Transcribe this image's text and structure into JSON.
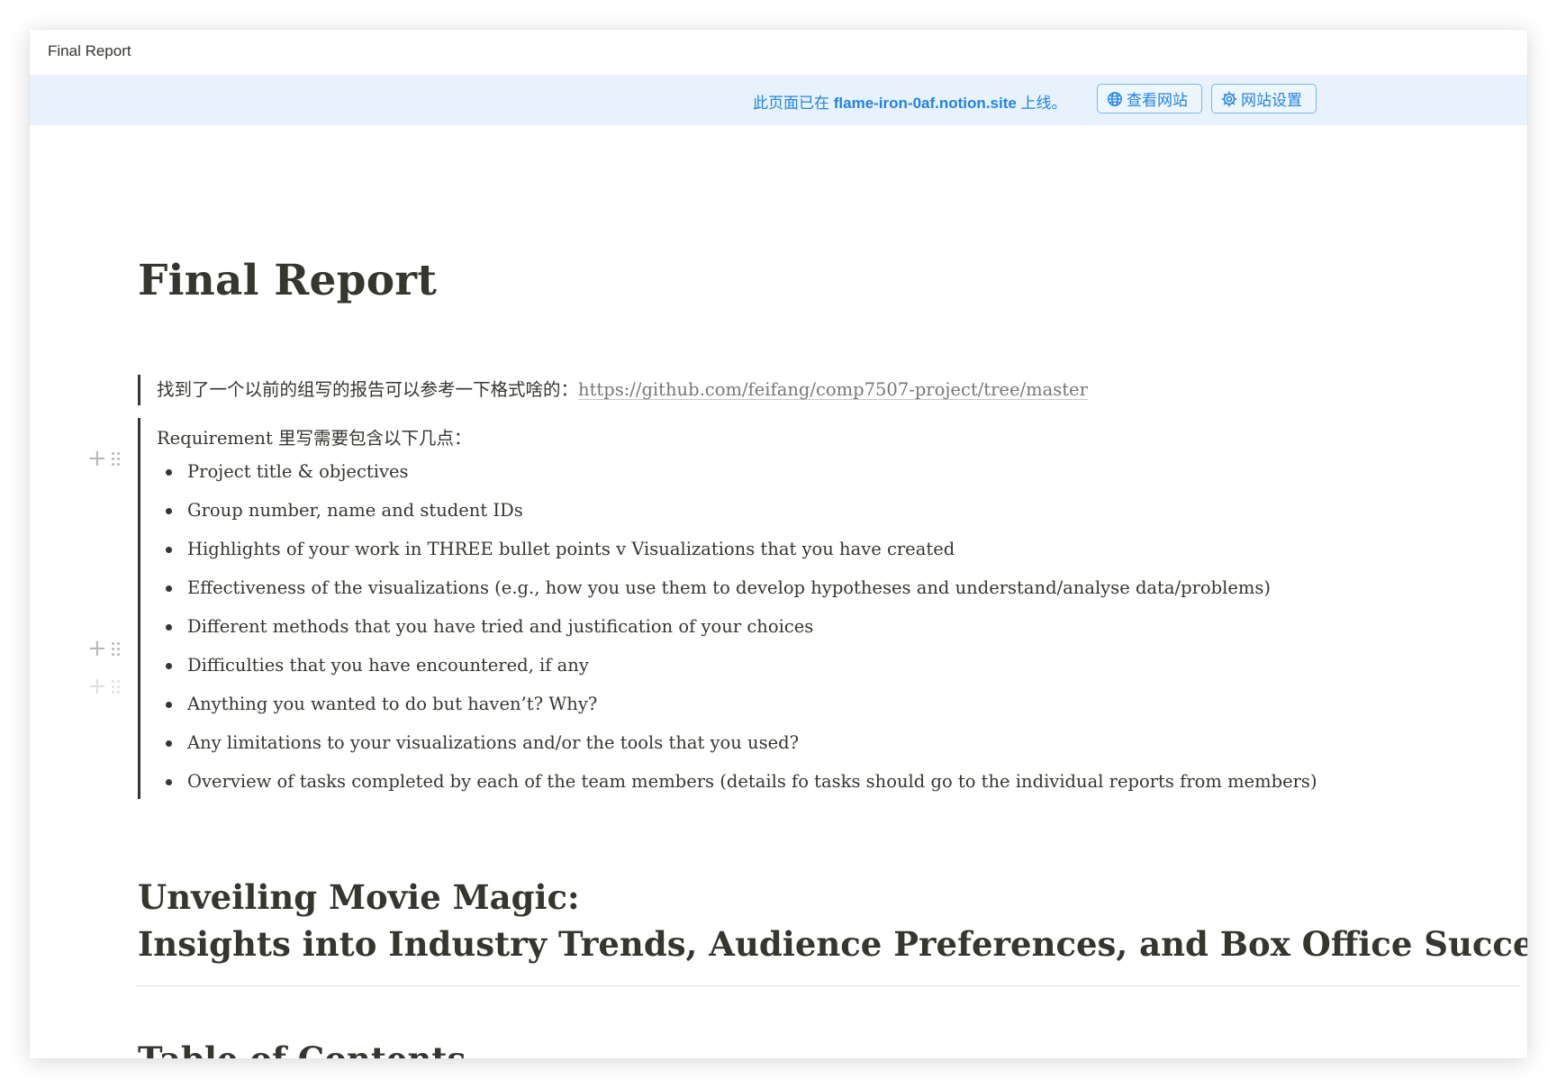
{
  "topbar": {
    "title": "Final Report"
  },
  "banner": {
    "text_prefix": "此页面已在",
    "domain": "flame-iron-0af.notion.site",
    "text_suffix": "上线。",
    "view_site_label": "查看网站",
    "site_settings_label": "网站设置",
    "view_site_icon": "globe-icon",
    "site_settings_icon": "gear-icon",
    "accent_color": "#2383e2",
    "background_color": "#e7f2fc"
  },
  "page": {
    "title": "Final Report",
    "reference_quote": {
      "text": "找到了一个以前的组写的报告可以参考一下格式啥的：",
      "link": "https://github.com/feifang/comp7507-project/tree/master"
    },
    "requirements_quote": {
      "intro": "Requirement 里写需要包含以下几点：",
      "items": [
        "Project title & objectives",
        "Group number, name and student IDs",
        "Highlights of your work in THREE bullet points v Visualizations that you have created",
        "Effectiveness of the visualizations (e.g., how you use them to develop hypotheses and understand/analyse data/problems)",
        "Different methods that you have tried and justification of your choices",
        "Difficulties that you have encountered, if any",
        "Anything you wanted to do but haven’t? Why?",
        "Any limitations to your visualizations and/or the tools that you used?",
        "Overview of tasks completed by each of the team members (details fo tasks should go to the individual reports from members)"
      ]
    },
    "heading1_line1": "Unveiling Movie Magic:",
    "heading1_line2": "Insights into Industry Trends, Audience Preferences, and Box Office Success",
    "toc_heading": "Table of Contents",
    "block_handle_plus": "+"
  }
}
